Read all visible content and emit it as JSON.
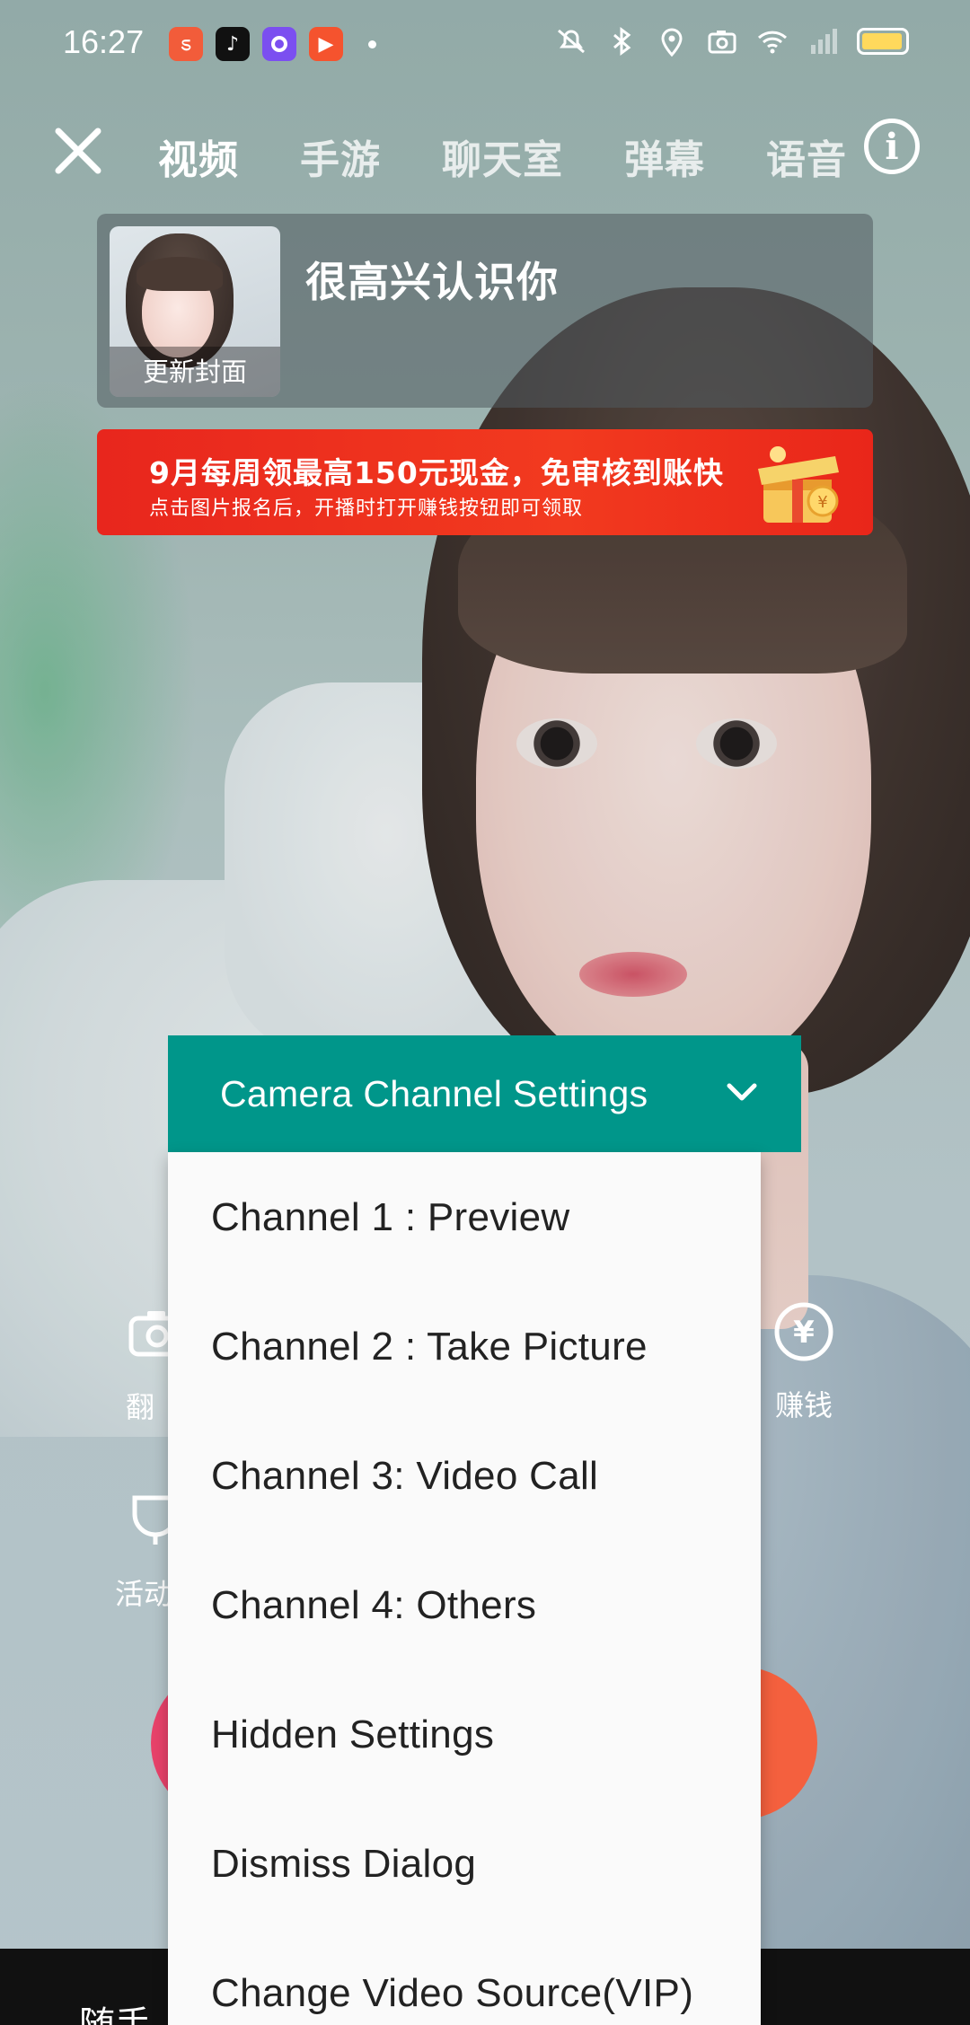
{
  "status_bar": {
    "time": "16:27",
    "battery_level": 0.95,
    "colors": {
      "battery_fill": "#ffd95c"
    },
    "icons": [
      "app-icon-1",
      "tiktok-icon",
      "app-icon-3",
      "video-app-icon",
      "mute-icon",
      "bluetooth-icon",
      "location-icon",
      "camera-icon",
      "wifi-icon",
      "signal-icon",
      "battery-icon"
    ]
  },
  "top_nav": {
    "tabs": [
      {
        "label": "视频",
        "active": true
      },
      {
        "label": "手游",
        "active": false
      },
      {
        "label": "聊天室",
        "active": false
      },
      {
        "label": "弹幕",
        "active": false
      },
      {
        "label": "语音",
        "active": false
      }
    ]
  },
  "room_card": {
    "cover_label": "更新封面",
    "title": "很高兴认识你"
  },
  "promo": {
    "line1": "9月每周领最高150元现金，免审核到账快",
    "line2": "点击图片报名后，开播时打开赚钱按钮即可领取",
    "color": "#e8261d"
  },
  "controls": {
    "flip_label": "翻",
    "earn_label": "赚钱",
    "activity_label": "活动",
    "bottom_text": "随手"
  },
  "dialog": {
    "title": "Camera Channel Settings",
    "header_color": "#00968a",
    "items": [
      "Channel 1 : Preview",
      "Channel 2 : Take Picture",
      "Channel 3: Video Call",
      "Channel 4: Others",
      "Hidden Settings",
      "Dismiss Dialog",
      "Change Video Source(VIP)"
    ]
  }
}
